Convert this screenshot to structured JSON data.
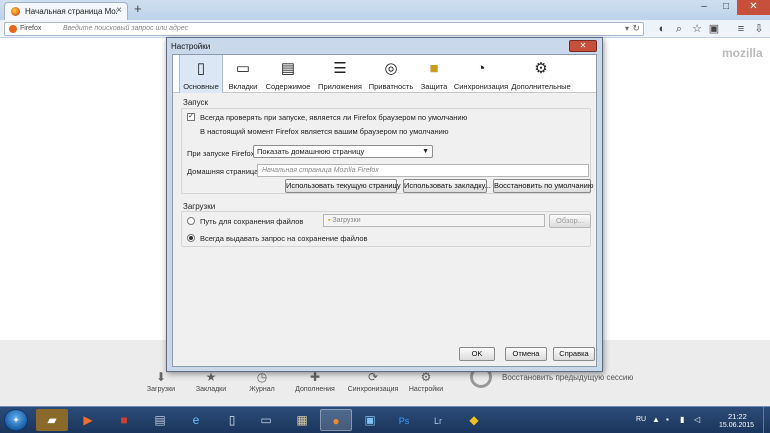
{
  "browser": {
    "tab_title": "Начальная страница Mozi...",
    "tab_close": "×",
    "new_tab": "+",
    "win_min": "–",
    "win_max": "□",
    "win_close": "✕",
    "identity_label": "Firefox",
    "url_placeholder": "Введите поисковый запрос или адрес",
    "brand": "mozilla"
  },
  "quick_access": [
    {
      "label": "Загрузки",
      "icon": "download-icon"
    },
    {
      "label": "Закладки",
      "icon": "bookmark-icon"
    },
    {
      "label": "Журнал",
      "icon": "history-icon"
    },
    {
      "label": "Дополнения",
      "icon": "addons-icon"
    },
    {
      "label": "Синхронизация",
      "icon": "sync-icon"
    },
    {
      "label": "Настройки",
      "icon": "gear-icon"
    }
  ],
  "restore_session": "Восстановить предыдущую сессию",
  "dialog": {
    "title": "Настройки",
    "close": "✕",
    "panes": [
      {
        "label": "Основные",
        "icon": "general-icon",
        "selected": true
      },
      {
        "label": "Вкладки",
        "icon": "tabs-icon"
      },
      {
        "label": "Содержимое",
        "icon": "content-icon"
      },
      {
        "label": "Приложения",
        "icon": "applications-icon"
      },
      {
        "label": "Приватность",
        "icon": "privacy-icon"
      },
      {
        "label": "Защита",
        "icon": "lock-icon"
      },
      {
        "label": "Синхронизация",
        "icon": "sync-icon"
      },
      {
        "label": "Дополнительные",
        "icon": "gear-icon"
      }
    ],
    "startup": {
      "title": "Запуск",
      "check_default": "Всегда проверять при запуске, является ли Firefox браузером по умолчанию",
      "check_default_checked": true,
      "is_default_text": "В настоящий момент Firefox является вашим браузером по умолчанию",
      "when_start_label": "При запуске Firefox:",
      "when_start_value": "Показать домашнюю страницу",
      "homepage_label": "Домашняя страница:",
      "homepage_placeholder": "Начальная страница Mozilla Firefox",
      "btn_use_current": "Использовать текущую страницу",
      "btn_use_bookmark": "Использовать закладку...",
      "btn_restore_default": "Восстановить по умолчанию"
    },
    "downloads": {
      "title": "Загрузки",
      "save_to_label": "Путь для сохранения файлов",
      "save_to_value": "Загрузки",
      "browse": "Обзор...",
      "always_ask_label": "Всегда выдавать запрос на сохранение файлов",
      "always_ask_selected": true
    },
    "ok": "OK",
    "cancel": "Отмена",
    "help": "Справка"
  },
  "taskbar": {
    "lang": "RU",
    "time": "21:22",
    "date": "15.06.2015"
  }
}
